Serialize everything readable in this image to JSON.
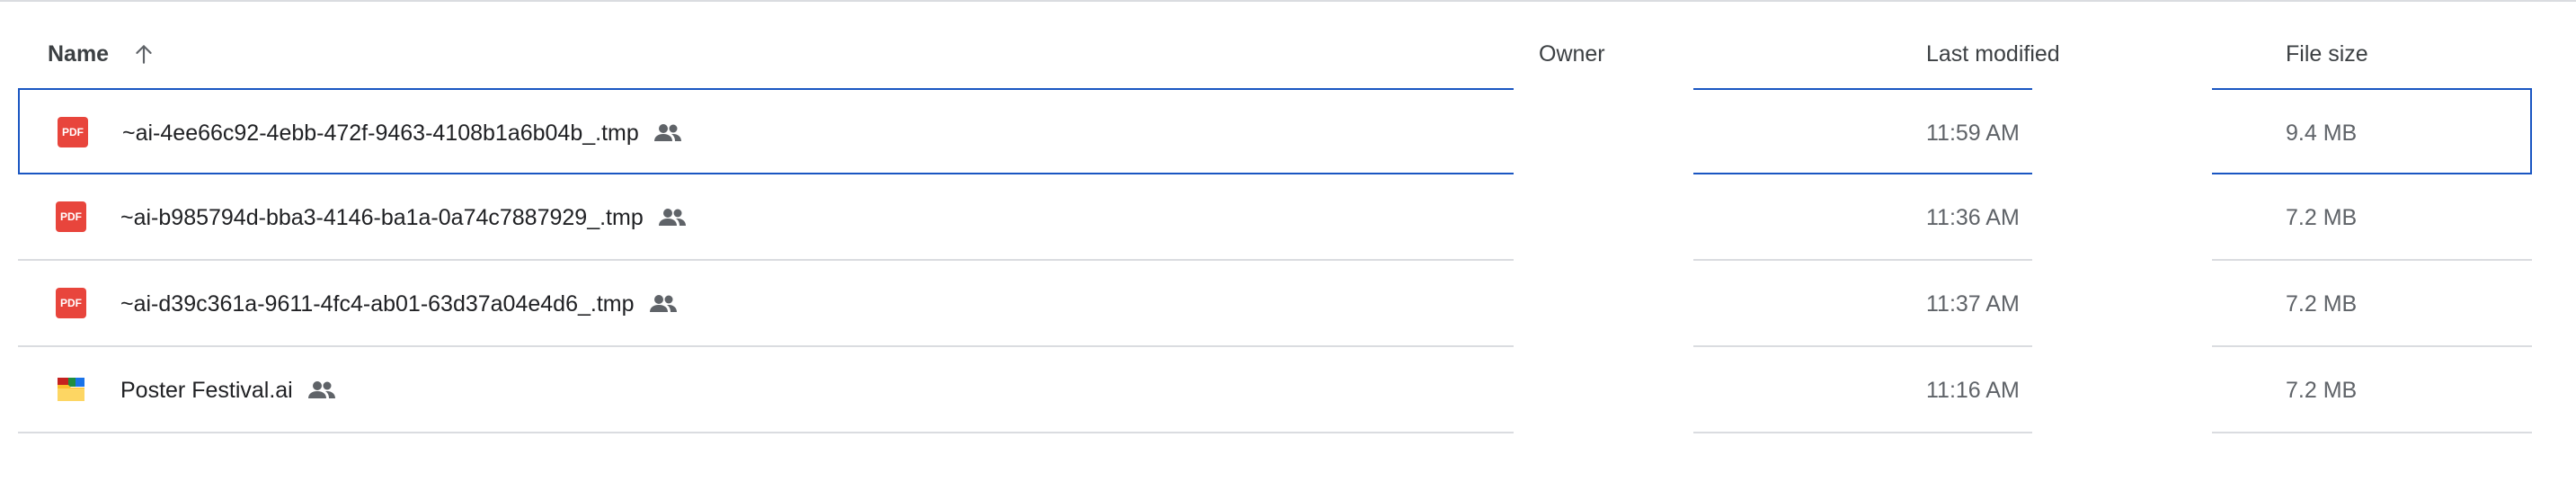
{
  "columns": {
    "name": "Name",
    "owner": "Owner",
    "last_modified": "Last modified",
    "file_size": "File size"
  },
  "sort": {
    "column": "name",
    "direction": "ascending",
    "icon": "arrow-up-icon"
  },
  "files": [
    {
      "name": "~ai-4ee66c92-4ebb-472f-9463-4108b1a6b04b_.tmp",
      "type": "pdf",
      "icon_label": "PDF",
      "shared": true,
      "modified": "11:59 AM",
      "size": "9.4 MB",
      "selected": true
    },
    {
      "name": "~ai-b985794d-bba3-4146-ba1a-0a74c7887929_.tmp",
      "type": "pdf",
      "icon_label": "PDF",
      "shared": true,
      "modified": "11:36 AM",
      "size": "7.2 MB",
      "selected": false
    },
    {
      "name": "~ai-d39c361a-9611-4fc4-ab01-63d37a04e4d6_.tmp",
      "type": "pdf",
      "icon_label": "PDF",
      "shared": true,
      "modified": "11:37 AM",
      "size": "7.2 MB",
      "selected": false
    },
    {
      "name": "Poster Festival.ai",
      "type": "shared-folder",
      "icon_label": "",
      "shared": true,
      "modified": "11:16 AM",
      "size": "7.2 MB",
      "selected": false
    }
  ],
  "colors": {
    "selection_border": "#1a56c2",
    "pdf_red": "#e8453c",
    "divider": "#dadce0"
  }
}
